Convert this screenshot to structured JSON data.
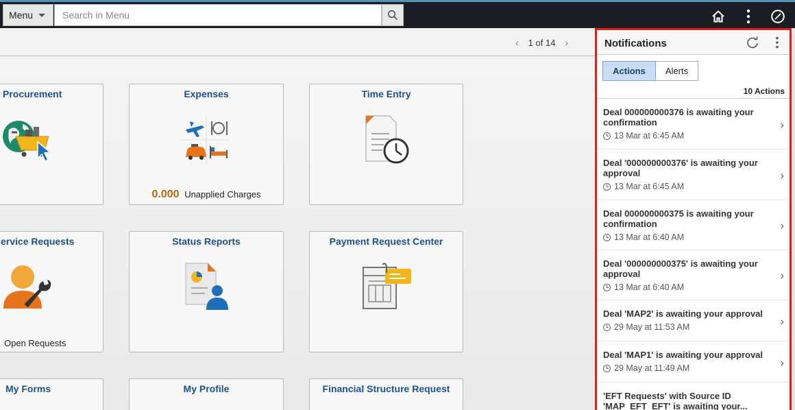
{
  "header": {
    "menu_label": "Menu",
    "search_placeholder": "Search in Menu",
    "icons": [
      "home-icon",
      "more-vertical-icon",
      "navigator-compass-icon"
    ]
  },
  "pager": {
    "text": "1 of 14"
  },
  "tiles": {
    "procurement": {
      "title": "Procurement"
    },
    "expenses": {
      "title": "Expenses",
      "value": "0.000",
      "label": "Unapplied Charges"
    },
    "time_entry": {
      "title": "Time Entry"
    },
    "service_requests": {
      "title": "ervice Requests",
      "footer": "Open Requests"
    },
    "status_reports": {
      "title": "Status Reports"
    },
    "payment_request_center": {
      "title": "Payment Request Center"
    },
    "my_forms": {
      "title": "My Forms"
    },
    "my_profile": {
      "title": "My Profile"
    },
    "financial_structure_request": {
      "title": "Financial Structure Request"
    }
  },
  "notifications": {
    "title": "Notifications",
    "tabs": {
      "actions": "Actions",
      "alerts": "Alerts"
    },
    "count_label": "10 Actions",
    "items": [
      {
        "text": "Deal 000000000376 is awaiting your confirmation",
        "time": "13 Mar at 6:45 AM"
      },
      {
        "text": "Deal '000000000376' is awaiting your approval",
        "time": "13 Mar at 6:45 AM"
      },
      {
        "text": "Deal 000000000375 is awaiting your confirmation",
        "time": "13 Mar at 6:40 AM"
      },
      {
        "text": "Deal '000000000375' is awaiting your approval",
        "time": "13 Mar at 6:40 AM"
      },
      {
        "text": "Deal 'MAP2' is awaiting your approval",
        "time": "29 May at 11:53 AM"
      },
      {
        "text": "Deal 'MAP1' is awaiting your approval",
        "time": "29 May at 11:49 AM"
      },
      {
        "text": "'EFT Requests' with Source ID 'MAP_EFT_EFT' is awaiting your...",
        "time": ""
      }
    ]
  },
  "colors": {
    "topbar": "#1a1d23",
    "tile_title": "#1d5289",
    "highlight_border": "#e0201c",
    "active_tab": "#c8dcf3",
    "value_orange": "#b56b11"
  }
}
